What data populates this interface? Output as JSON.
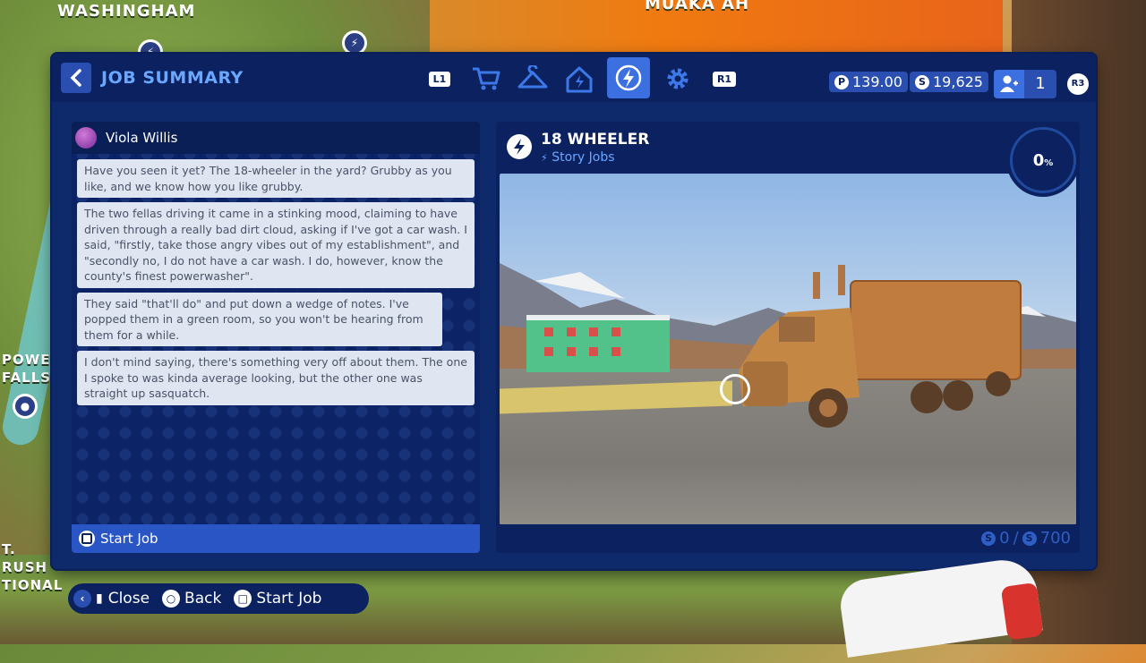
{
  "map": {
    "labels": [
      "WASHINGHAM",
      "MUAKA AH",
      "POWER FALLS",
      "T. RUSH TIONAL"
    ]
  },
  "header": {
    "title": "JOB SUMMARY",
    "tab_left_button": "L1",
    "tab_right_button": "R1",
    "tabs": [
      {
        "name": "shop",
        "icon": "cart-icon"
      },
      {
        "name": "wardrobe",
        "icon": "hanger-icon"
      },
      {
        "name": "home",
        "icon": "house-icon"
      },
      {
        "name": "jobs",
        "icon": "bolt-icon",
        "active": true
      },
      {
        "name": "settings",
        "icon": "gear-icon"
      }
    ],
    "premium_currency": "139.00",
    "premium_symbol": "P",
    "money": "19,625",
    "money_symbol": "S",
    "player_count": "1",
    "player_button": "R3"
  },
  "chat": {
    "contact_name": "Viola Willis",
    "messages": [
      "Have you seen it yet? The 18-wheeler in the yard? Grubby as you like, and we know how you like grubby.",
      "The two fellas driving it came in a stinking mood, claiming to have driven through a really bad dirt cloud, asking if I've got a car wash. I said, \"firstly, take those angry vibes out of my establishment\", and \"secondly no, I do not have a car wash. I do, however, know the county's finest powerwasher\".",
      "They said \"that'll do\" and put down a wedge of notes. I've popped them in a green room, so you won't be hearing from them for a while.",
      "I don't mind saying, there's something very off about them. The one I spoke to was kinda average looking, but the other one was straight up sasquatch."
    ],
    "start_label": "Start Job"
  },
  "job": {
    "title": "18 WHEELER",
    "category": "Story Jobs",
    "progress_value": "0",
    "progress_unit": "%",
    "earned": "0",
    "total": "700",
    "separator": "/"
  },
  "footer": {
    "close": "Close",
    "back": "Back",
    "start": "Start Job"
  },
  "colors": {
    "panel": "#0f2a6b",
    "header": "#0b2160",
    "accent": "#3c6fe0",
    "title_blue": "#6aa7ff",
    "bubble": "#dfe6f2"
  }
}
